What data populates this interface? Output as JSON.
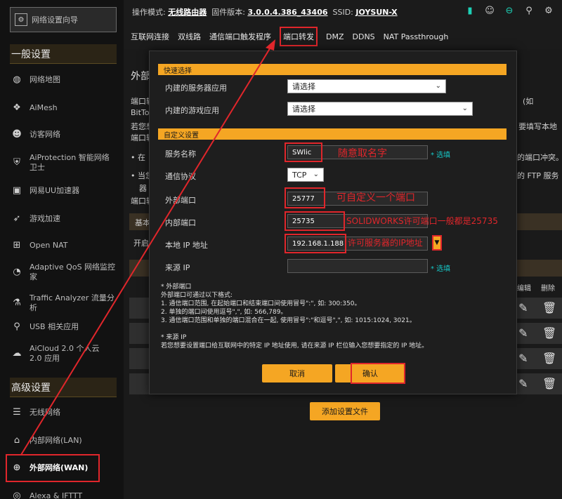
{
  "sidebar": {
    "wizard": "网络设置向导",
    "section_general": "一般设置",
    "section_advanced": "高级设置",
    "general_items": [
      {
        "label": "网络地图",
        "icon": "globe-icon"
      },
      {
        "label": "AiMesh",
        "icon": "mesh-icon"
      },
      {
        "label": "访客网络",
        "icon": "guest-icon"
      },
      {
        "label": "AiProtection 智能网络卫士",
        "icon": "shield-icon"
      },
      {
        "label": "网易UU加速器",
        "icon": "gamepad-icon"
      },
      {
        "label": "游戏加速",
        "icon": "rocket-icon"
      },
      {
        "label": "Open NAT",
        "icon": "nat-icon"
      },
      {
        "label": "Adaptive QoS 网络监控家",
        "icon": "qos-icon"
      },
      {
        "label": "Traffic Analyzer 流量分析",
        "icon": "analyzer-icon"
      },
      {
        "label": "USB 相关应用",
        "icon": "usb-icon"
      },
      {
        "label": "AiCloud 2.0 个人云 2.0 应用",
        "icon": "cloud-icon"
      }
    ],
    "advanced_items": [
      {
        "label": "无线网络",
        "icon": "wifi-icon"
      },
      {
        "label": "内部网络(LAN)",
        "icon": "lan-icon"
      },
      {
        "label": "外部网络(WAN)",
        "icon": "wan-icon"
      },
      {
        "label": "Alexa & IFTTT",
        "icon": "alexa-icon"
      }
    ]
  },
  "header": {
    "mode_label": "操作模式:",
    "mode_value": "无线路由器",
    "fw_label": "固件版本:",
    "fw_value": "3.0.0.4.386_43406",
    "ssid_label": "SSID:",
    "ssid_value": "JOYSUN-X"
  },
  "tabs": [
    "互联网连接",
    "双线路",
    "通信端口触发程序",
    "端口转发",
    "DMZ",
    "DDNS",
    "NAT Passthrough"
  ],
  "background": {
    "title": "外部",
    "line1a": "端口转",
    "line1b": "(如",
    "line2": "BitTo",
    "line3a": "若您想",
    "line3b": "要填写本地",
    "line4a": "端口转",
    "bullet1a": "• 在",
    "bullet1b": "的端口冲突。",
    "bullet2a": "• 当您",
    "bullet2b": "的 FTP 服务",
    "line5": "器",
    "line6": "端口转",
    "bar1": "基本",
    "open_label": "开启",
    "col_edit": "编辑",
    "col_delete": "删除",
    "add_button": "添加设置文件"
  },
  "modal": {
    "quick_title": "快速选择",
    "builtin_server_label": "内建的服务器应用",
    "builtin_server_value": "请选择",
    "builtin_game_label": "内建的游戏应用",
    "builtin_game_value": "请选择",
    "custom_title": "自定义设置",
    "service_label": "服务名称",
    "service_value": "SWlic",
    "service_hint": "* 选填",
    "protocol_label": "通信协议",
    "protocol_value": "TCP",
    "ext_port_label": "外部端口",
    "ext_port_value": "25777",
    "int_port_label": "内部端口",
    "int_port_value": "25735",
    "local_ip_label": "本地 IP 地址",
    "local_ip_value": "192.168.1.188",
    "source_ip_label": "来源 IP",
    "source_hint": "* 选填",
    "notes": [
      "* 外部端口",
      "外部端口可通过以下格式:",
      "1. 通信端口范围, 在起始端口和结束端口间使用冒号\":\", 如: 300:350。",
      "2. 单独的端口间使用逗号\",\", 如: 566,789。",
      "3. 通信端口范围和单独的端口混合在一起, 使用冒号\":\"和逗号\",\", 如: 1015:1024, 3021。",
      "",
      "* 来源 IP",
      "若您想要设置端口给互联网中的特定 IP 地址使用, 请在来源 IP 栏位输入您想要指定的 IP 地址。"
    ],
    "cancel": "取消",
    "confirm": "确认"
  },
  "annotations": {
    "name_note": "随意取名字",
    "ext_note": "可自定义一个端口",
    "int_note": "SOLIDWORKS许可端口一般都是25735",
    "ip_note": "许可服务器的IP地址"
  },
  "colors": {
    "accent": "#f5a623",
    "annotation": "#e0262b",
    "hint": "#16c6c6"
  }
}
